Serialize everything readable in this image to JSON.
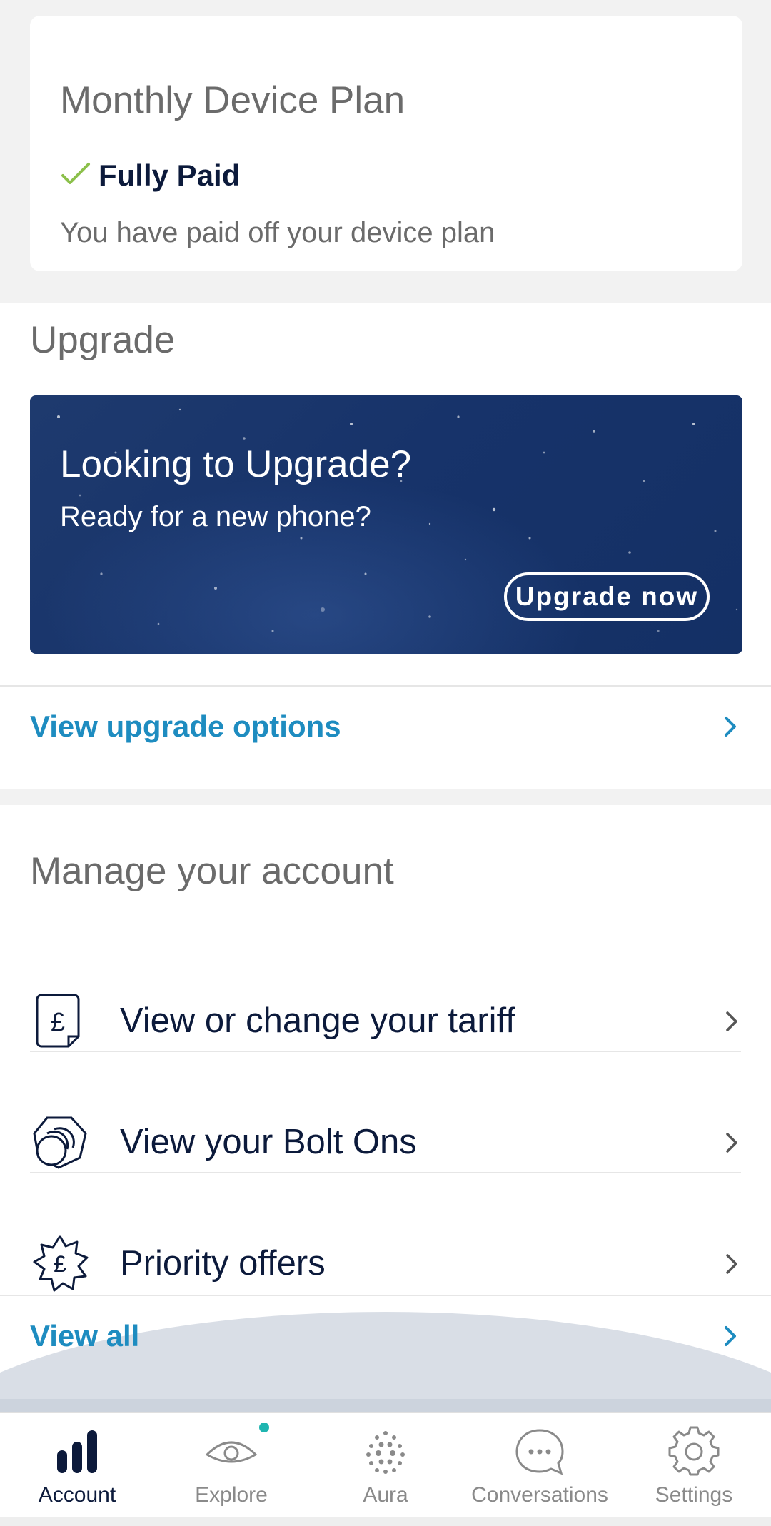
{
  "plan": {
    "title": "Monthly Device Plan",
    "status": "Fully Paid",
    "description": "You have paid off your device plan",
    "status_color": "#8cc04b"
  },
  "upgrade": {
    "heading": "Upgrade",
    "banner_title": "Looking to Upgrade?",
    "banner_subtitle": "Ready for a new phone?",
    "banner_button": "Upgrade now",
    "link": "View upgrade options"
  },
  "manage": {
    "heading": "Manage your account",
    "items": [
      {
        "label": "View or change your tariff",
        "icon": "pound-document-icon"
      },
      {
        "label": "View your Bolt Ons",
        "icon": "bolt-ons-icon"
      },
      {
        "label": "Priority offers",
        "icon": "pound-star-icon"
      }
    ],
    "view_all": "View all"
  },
  "nav": {
    "items": [
      {
        "label": "Account",
        "icon": "bar-chart-icon",
        "active": true
      },
      {
        "label": "Explore",
        "icon": "eye-icon",
        "active": false,
        "badge": true
      },
      {
        "label": "Aura",
        "icon": "dots-sphere-icon",
        "active": false
      },
      {
        "label": "Conversations",
        "icon": "chat-bubble-icon",
        "active": false
      },
      {
        "label": "Settings",
        "icon": "gear-icon",
        "active": false
      }
    ]
  },
  "colors": {
    "navy": "#0c1a3b",
    "link_blue": "#1e8cc0",
    "banner_blue": "#17336a",
    "badge_teal": "#1fb5b0",
    "check_green": "#8cc04b"
  }
}
